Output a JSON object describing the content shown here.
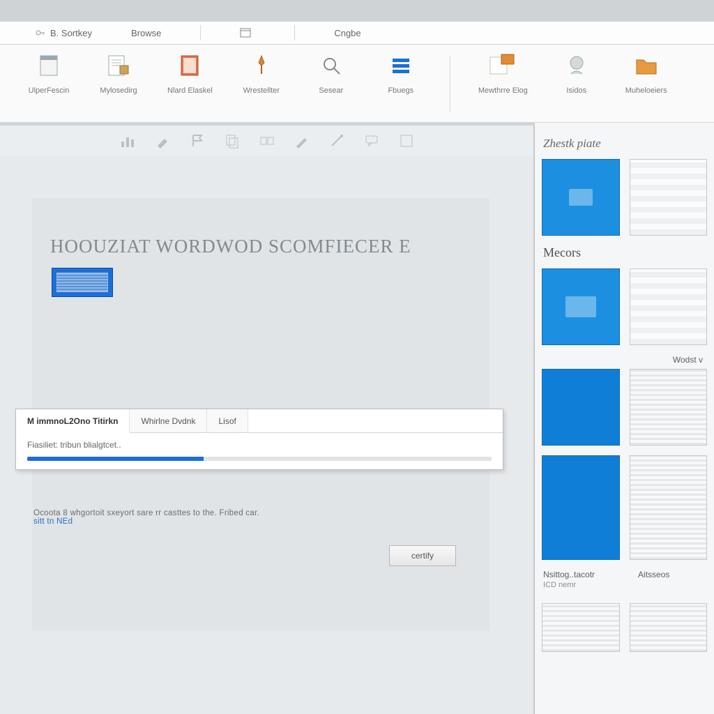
{
  "menubar": {
    "items": [
      {
        "label": "B. Sortkey"
      },
      {
        "label": "Browse"
      },
      {
        "label": ""
      },
      {
        "label": "Cngbe"
      }
    ]
  },
  "ribbon": {
    "groups": [
      {
        "label": "UlperFescin",
        "icon": "page-icon"
      },
      {
        "label": "Mylosedirg",
        "icon": "page-lines-icon"
      },
      {
        "label": "Nlard Elaskel",
        "icon": "notebook-icon"
      },
      {
        "label": "Wrestellter",
        "icon": "pin-icon"
      },
      {
        "label": "Sesear",
        "icon": "search-icon"
      },
      {
        "label": "Fbuegs",
        "icon": "list-icon"
      },
      {
        "label": "Mewthrre Elog",
        "icon": "folder-icon"
      },
      {
        "label": "Isidos",
        "icon": "head-icon"
      },
      {
        "label": "Muheloeiers",
        "icon": "folder2-icon"
      }
    ]
  },
  "subtoolbar": {
    "buttons": [
      "chart-icon",
      "brush-icon",
      "flag-icon",
      "copy-icon",
      "group-icon",
      "pencil-icon",
      "wand-icon",
      "chat-icon",
      "expand-icon"
    ]
  },
  "document": {
    "title": "HOOUZIAT WORDWOD SCOMFIECER E",
    "dialog": {
      "tabs": [
        {
          "label": "M immnoL2Ono Titirkn",
          "active": true
        },
        {
          "label": "Whirlne Dvdnk",
          "active": false
        },
        {
          "label": "Lisof",
          "active": false
        }
      ],
      "body": "Fiasiliet: tribun blialgtcet..",
      "footer": "Ocoota 8 whgortoit sxeyort sare rr casttes to the.  Fribed car.",
      "footer_emph": "sitt tn NEd"
    },
    "certify_label": "certify"
  },
  "rightpanel": {
    "section1_title": "Zhestk piate",
    "section2_title": "Mecors",
    "section3_title": "Wodst v",
    "section4_title": "Nsittog..tacotr",
    "section4_sub": "ICD nemr",
    "section5_title": "Aitsseos"
  }
}
